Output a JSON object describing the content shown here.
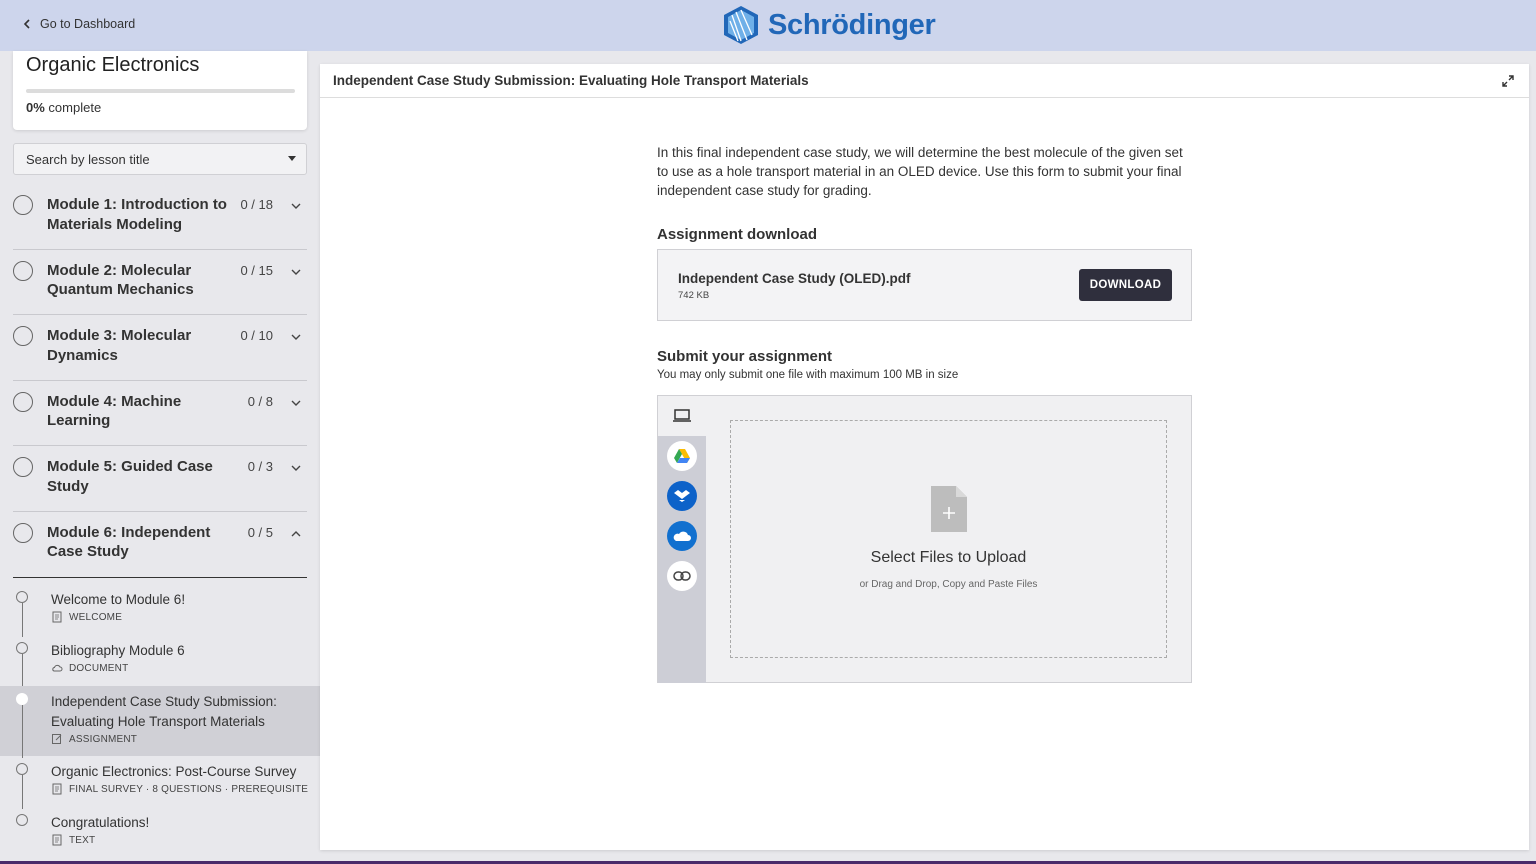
{
  "header": {
    "back_label": "Go to Dashboard",
    "brand": "Schrödinger"
  },
  "sidebar": {
    "course_title": "Organic Electronics",
    "progress_value": "0%",
    "progress_suffix": "complete",
    "progress_fraction": 0,
    "search_placeholder": "Search by lesson title",
    "modules": [
      {
        "title": "Module 1: Introduction to Materials Modeling",
        "count": "0 / 18",
        "expanded": false
      },
      {
        "title": "Module 2: Molecular Quantum Mechanics",
        "count": "0 / 15",
        "expanded": false
      },
      {
        "title": "Module 3: Molecular Dynamics",
        "count": "0 / 10",
        "expanded": false
      },
      {
        "title": "Module 4: Machine Learning",
        "count": "0 / 8",
        "expanded": false
      },
      {
        "title": "Module 5: Guided Case Study",
        "count": "0 / 3",
        "expanded": false
      },
      {
        "title": "Module 6: Independent Case Study",
        "count": "0 / 5",
        "expanded": true
      }
    ],
    "lessons": [
      {
        "title": "Welcome to Module 6!",
        "meta": "WELCOME",
        "icon": "document-icon"
      },
      {
        "title": "Bibliography Module 6",
        "meta": "DOCUMENT",
        "icon": "cloud-icon"
      },
      {
        "title": "Independent Case Study Submission: Evaluating Hole Transport Materials",
        "meta": "ASSIGNMENT",
        "icon": "edit-icon",
        "active": true
      },
      {
        "title": "Organic Electronics: Post-Course Survey",
        "meta": "FINAL SURVEY · 8 QUESTIONS · PREREQUISITE",
        "icon": "document-icon"
      },
      {
        "title": "Congratulations!",
        "meta": "TEXT",
        "icon": "document-icon"
      }
    ]
  },
  "main": {
    "title": "Independent Case Study Submission: Evaluating Hole Transport Materials",
    "intro": "In this final independent case study, we will determine the best molecule of the given set to use as a hole transport material in an OLED device. Use this form to submit your final independent case study for grading.",
    "download_heading": "Assignment download",
    "file_name": "Independent Case Study (OLED).pdf",
    "file_size": "742 KB",
    "download_button": "DOWNLOAD",
    "submit_heading": "Submit your assignment",
    "submit_note": "You may only submit one file with maximum 100 MB in size",
    "upload_title": "Select Files to Upload",
    "upload_sub": "or Drag and Drop, Copy and Paste Files",
    "upload_sources": [
      "computer-icon",
      "google-drive-icon",
      "dropbox-icon",
      "onedrive-icon",
      "link-icon"
    ]
  },
  "colors": {
    "header_bg": "#cdd5ec",
    "brand": "#2167b8",
    "button_bg": "#2f2f3d",
    "active_lesson_bg": "#d0d0d6"
  }
}
